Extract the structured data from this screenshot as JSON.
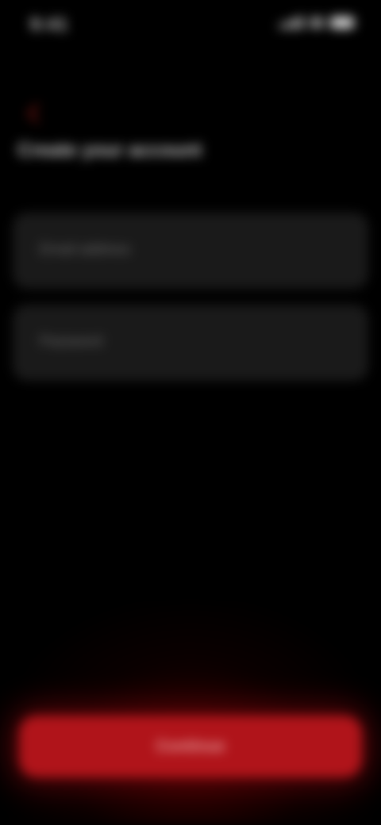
{
  "status_bar": {
    "time": "9:41"
  },
  "header": {
    "title": "Create your account"
  },
  "form": {
    "fields": [
      {
        "label": "Email address"
      },
      {
        "label": "Password"
      }
    ]
  },
  "footer": {
    "continue_label": "Continue"
  },
  "colors": {
    "background": "#000000",
    "field_background": "#1a1a1a",
    "accent": "#b0141a",
    "back_icon": "#7a1410"
  },
  "icons": {
    "back": "chevron-left-icon"
  }
}
